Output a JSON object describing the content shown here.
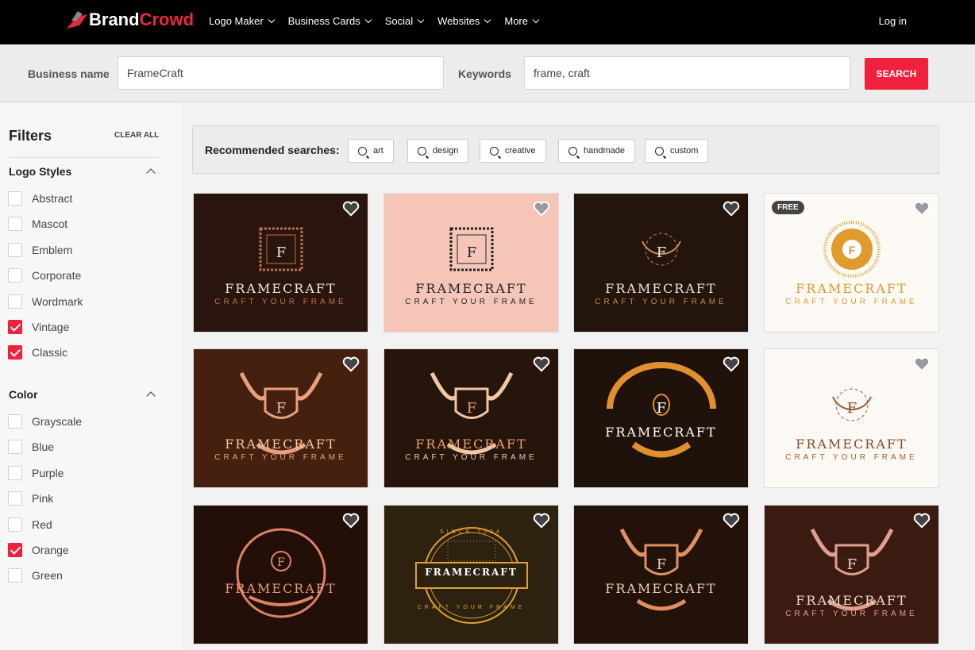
{
  "nav": {
    "brand_a": "Brand",
    "brand_b": "Crowd",
    "items": [
      "Logo Maker",
      "Business Cards",
      "Social",
      "Websites",
      "More"
    ],
    "login": "Log in"
  },
  "search": {
    "business_label": "Business name",
    "business_value": "FrameCraft",
    "keywords_label": "Keywords",
    "keywords_value": "frame, craft",
    "button": "SEARCH"
  },
  "filters": {
    "title": "Filters",
    "clear": "CLEAR ALL",
    "sections": [
      {
        "title": "Logo Styles",
        "options": [
          {
            "label": "Abstract",
            "checked": false
          },
          {
            "label": "Mascot",
            "checked": false
          },
          {
            "label": "Emblem",
            "checked": false
          },
          {
            "label": "Corporate",
            "checked": false
          },
          {
            "label": "Wordmark",
            "checked": false
          },
          {
            "label": "Vintage",
            "checked": true
          },
          {
            "label": "Classic",
            "checked": true
          }
        ]
      },
      {
        "title": "Color",
        "options": [
          {
            "label": "Grayscale",
            "checked": false
          },
          {
            "label": "Blue",
            "checked": false
          },
          {
            "label": "Purple",
            "checked": false
          },
          {
            "label": "Pink",
            "checked": false
          },
          {
            "label": "Red",
            "checked": false
          },
          {
            "label": "Orange",
            "checked": true
          },
          {
            "label": "Green",
            "checked": false
          }
        ]
      }
    ]
  },
  "recommended": {
    "label": "Recommended searches:",
    "chips": [
      "art",
      "design",
      "creative",
      "handmade",
      "custom"
    ]
  },
  "accent": "#f0213c",
  "cards": [
    {
      "name": "FRAMECRAFT",
      "tagline": "CRAFT YOUR FRAME",
      "bg": "#2a150e",
      "fg": "#f0e6dc",
      "accent": "#c0704a",
      "shape": "frame"
    },
    {
      "name": "FRAMECRAFT",
      "tagline": "CRAFT YOUR FRAME",
      "bg": "#f5c6b8",
      "fg": "#222222",
      "accent": "#222222",
      "shape": "frame"
    },
    {
      "name": "FRAMECRAFT",
      "tagline": "CRAFT YOUR FRAME",
      "bg": "#23140c",
      "fg": "#f0e6dc",
      "accent": "#c98a4a",
      "shape": "wreath"
    },
    {
      "name": "FRAMECRAFT",
      "tagline": "CRAFT YOUR FRAME",
      "bg": "#fdfaf5",
      "fg": "#e09a2e",
      "accent": "#e09a2e",
      "shape": "sun",
      "badge": "FREE"
    },
    {
      "name": "FRAMECRAFT",
      "tagline": "CRAFT YOUR FRAME",
      "bg": "#45200f",
      "fg": "#f3c8a8",
      "accent": "#e8a080",
      "shape": "crest"
    },
    {
      "name": "FRAMECRAFT",
      "tagline": "CRAFT YOUR FRAME",
      "bg": "#26150b",
      "fg": "#e8a070",
      "accent": "#f0c8a8",
      "shape": "crest"
    },
    {
      "name": "FRAMECRAFT",
      "tagline": "",
      "bg": "#1e120a",
      "fg": "#ffffff",
      "accent": "#e0902e",
      "shape": "arch"
    },
    {
      "name": "FRAMECRAFT",
      "tagline": "CRAFT YOUR FRAME",
      "bg": "#fcf8f4",
      "fg": "#8a4a2a",
      "accent": "#a0603a",
      "shape": "wreath"
    },
    {
      "name": "FRAMECRAFT",
      "tagline": "",
      "bg": "#221008",
      "fg": "#e89a78",
      "accent": "#e0806a",
      "shape": "circle"
    },
    {
      "name": "FRAMECRAFT",
      "tagline": "SINCE 2024",
      "bg": "#2d2210",
      "fg": "#ffffff",
      "accent": "#e0a030",
      "shape": "badge",
      "tagline2": "CRAFT YOUR FRAME"
    },
    {
      "name": "FRAMECRAFT",
      "tagline": "",
      "bg": "#22120a",
      "fg": "#f0d0b0",
      "accent": "#e09060",
      "shape": "crest"
    },
    {
      "name": "FRAMECRAFT",
      "tagline": "CRAFT YOUR FRAME",
      "bg": "#3b1a12",
      "fg": "#f0d8cc",
      "accent": "#e0a090",
      "shape": "crest"
    }
  ]
}
